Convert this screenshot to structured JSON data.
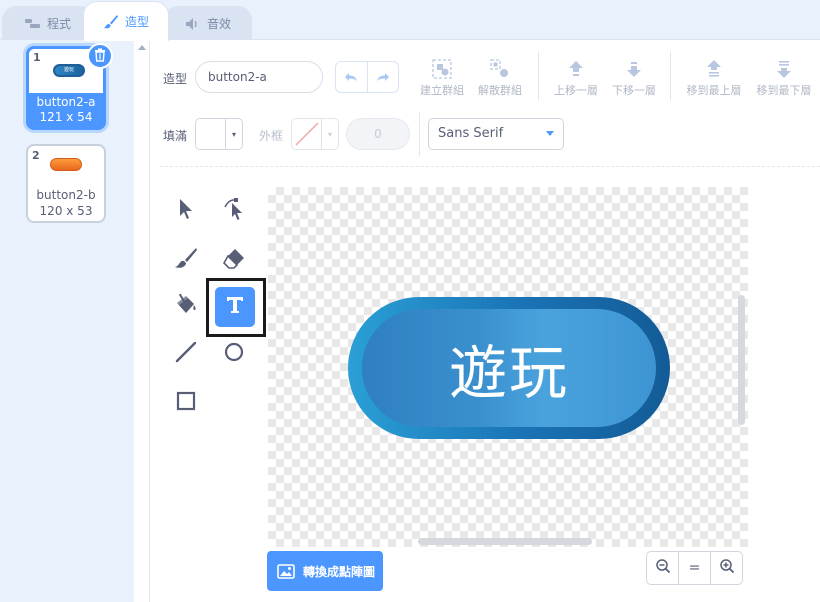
{
  "tabs": [
    {
      "label": "程式",
      "icon": "code-icon"
    },
    {
      "label": "造型",
      "icon": "brush-icon",
      "active": true
    },
    {
      "label": "音效",
      "icon": "sound-icon"
    }
  ],
  "costumes": [
    {
      "number": "1",
      "name": "button2-a",
      "size": "121 x 54",
      "thumb_text": "遊玩",
      "selected": true
    },
    {
      "number": "2",
      "name": "button2-b",
      "size": "120 x 53",
      "selected": false
    }
  ],
  "toolbar": {
    "costume_label": "造型",
    "costume_name": "button2-a",
    "group": "建立群組",
    "ungroup": "解散群組",
    "forward": "上移一層",
    "backward": "下移一層",
    "front": "移到最上層",
    "back": "移到最下層",
    "fill_label": "填滿",
    "outline_label": "外框",
    "outline_width": "0",
    "font": "Sans Serif"
  },
  "canvas": {
    "button_text": "遊玩"
  },
  "bottom": {
    "convert_label": "轉換成點陣圖",
    "zoom_reset": "="
  },
  "colors": {
    "accent": "#4c97ff",
    "fill": "#ffffff",
    "button_gradient_start": "#2a9fd6",
    "button_gradient_end": "#135b96"
  }
}
